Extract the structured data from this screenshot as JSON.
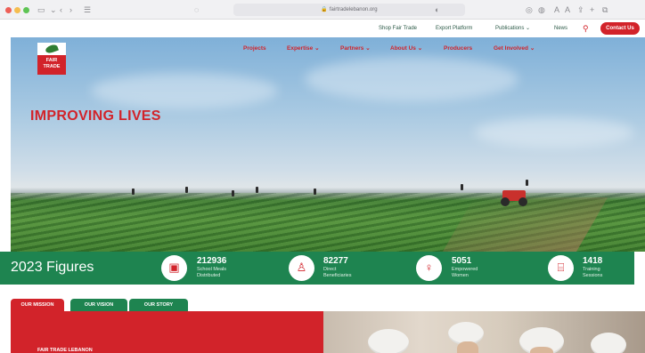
{
  "browser": {
    "url": "fairtradelebanon.org"
  },
  "utility_nav": {
    "links": [
      "Shop Fair Trade",
      "Export Platform",
      "Publications",
      "News"
    ],
    "contact_label": "Contact Us"
  },
  "logo": {
    "wordmark": "FAIR TRADE"
  },
  "main_nav": {
    "items": [
      "Projects",
      "Expertise",
      "Partners",
      "About Us",
      "Producers",
      "Get Involved"
    ]
  },
  "hero": {
    "title": "IMPROVING LIVES"
  },
  "figures": {
    "title": "2023 Figures",
    "stats": [
      {
        "value": "212936",
        "label_line1": "School Meals",
        "label_line2": "Distributed",
        "icon": "box-icon"
      },
      {
        "value": "82277",
        "label_line1": "Direct",
        "label_line2": "Beneficiaries",
        "icon": "person-icon"
      },
      {
        "value": "5051",
        "label_line1": "Empowered",
        "label_line2": "Women",
        "icon": "woman-icon"
      },
      {
        "value": "1418",
        "label_line1": "Training",
        "label_line2": "Sessions",
        "icon": "presentation-icon"
      }
    ]
  },
  "tabs": {
    "items": [
      "OUR MISSION",
      "OUR VISION",
      "OUR STORY"
    ],
    "active": "OUR MISSION"
  },
  "content": {
    "heading": "FAIR TRADE LEBANON"
  },
  "colors": {
    "brand_red": "#d2232a",
    "brand_green": "#1e8450"
  }
}
